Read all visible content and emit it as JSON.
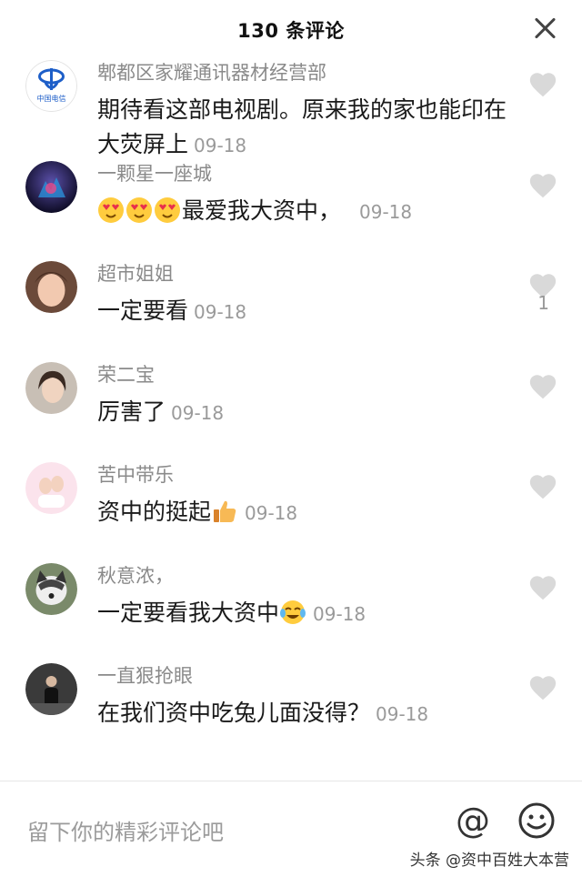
{
  "header": {
    "title": "130 条评论"
  },
  "comments": [
    {
      "user": "郫都区家耀通讯器材经营部",
      "text": "期待看这部电视剧。原来我的家也能印在大荧屏上",
      "time": "09-18",
      "likes": "",
      "avatar_text": "中国电信"
    },
    {
      "user": "一颗星一座城",
      "text": "最爱我大资中，",
      "time": "09-18",
      "likes": "",
      "emoji": "heart-eyes-icon x3"
    },
    {
      "user": "超市姐姐",
      "text": "一定要看",
      "time": "09-18",
      "likes": "1"
    },
    {
      "user": "荣二宝",
      "text": "厉害了",
      "time": "09-18",
      "likes": ""
    },
    {
      "user": "苦中带乐",
      "text": "资中的挺起",
      "time": "09-18",
      "likes": "",
      "emoji": "thumbs-up-icon"
    },
    {
      "user": "秋意浓，",
      "text": "一定要看我大资中",
      "time": "09-18",
      "likes": "",
      "emoji": "tears-of-joy-icon"
    },
    {
      "user": "一直狠抢眼",
      "text": "在我们资中吃兔儿面没得？",
      "time": "09-18",
      "likes": ""
    }
  ],
  "footer": {
    "placeholder": "留下你的精彩评论吧",
    "at_symbol": "@",
    "watermark": "头条 @资中百姓大本营"
  },
  "colors": {
    "heart": "#d9d9d9",
    "username": "#8a8a8a",
    "time": "#9a9a9a"
  }
}
